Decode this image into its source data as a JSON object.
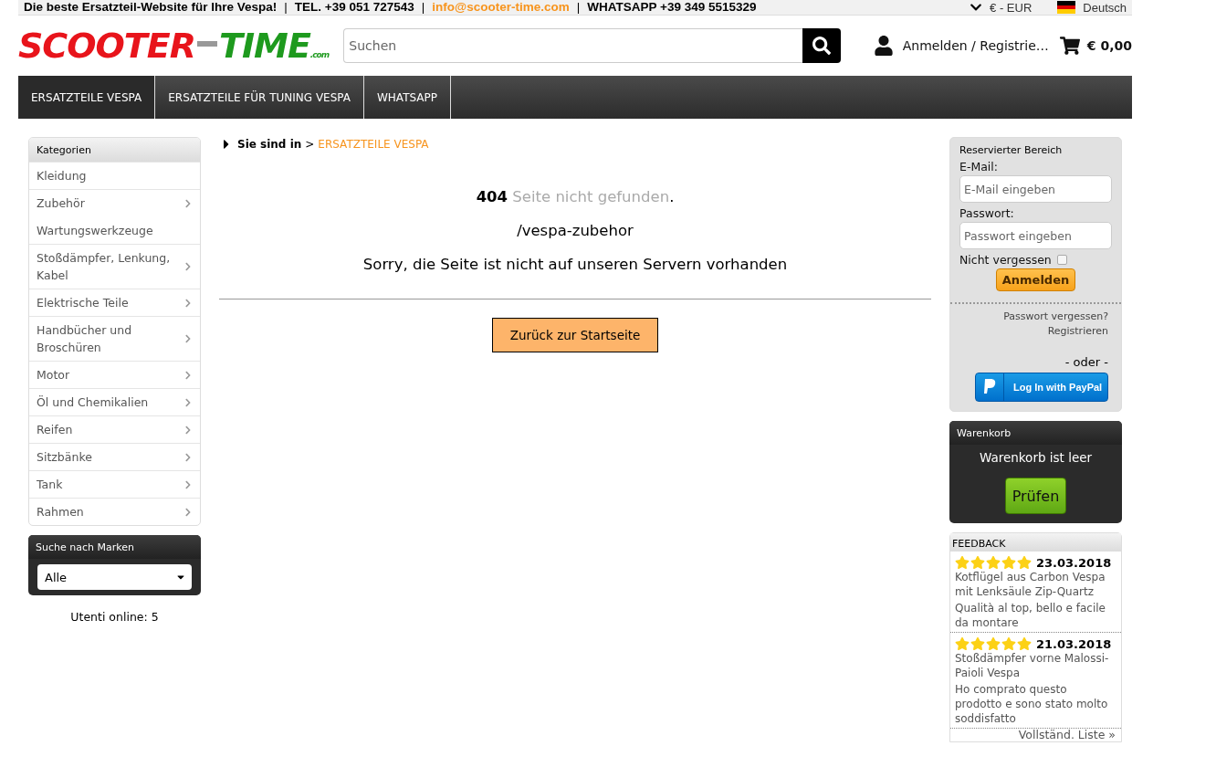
{
  "topbar": {
    "slogan": "Die beste Ersatzteil-Website für Ihre Vespa!",
    "phone": "TEL. +39 051 727543",
    "email": "info@scooter-time.com",
    "whatsapp": "WHATSAPP  +39 349 5515329",
    "currency": "€ - EUR",
    "language": "Deutsch",
    "separator": "|"
  },
  "logo": {
    "part_1": "SCOOTER",
    "part_2": "TIME",
    "suffix": ".com"
  },
  "search": {
    "placeholder": "Suchen"
  },
  "account": {
    "label": "Anmelden / Registrie…"
  },
  "cart_total": "€ 0,00",
  "nav": [
    {
      "label": "ERSATZTEILE VESPA",
      "selected": true
    },
    {
      "label": "ERSATZTEILE FÜR TUNING VESPA",
      "selected": false
    },
    {
      "label": "WHATSAPP",
      "selected": false
    }
  ],
  "categories": {
    "title": "Kategorien",
    "items": [
      {
        "label": "Kleidung",
        "has_children": false
      },
      {
        "label": "Zubehör",
        "has_children": true
      },
      {
        "label": "Wartungswerkzeuge",
        "has_children": false
      },
      {
        "label": "Stoßdämpfer, Lenkung, Kabel",
        "has_children": true
      },
      {
        "label": "Elektrische Teile",
        "has_children": true
      },
      {
        "label": "Handbücher und Broschüren",
        "has_children": true
      },
      {
        "label": "Motor",
        "has_children": true
      },
      {
        "label": "Öl und Chemikalien",
        "has_children": true
      },
      {
        "label": "Reifen",
        "has_children": true
      },
      {
        "label": "Sitzbänke",
        "has_children": true
      },
      {
        "label": "Tank",
        "has_children": true
      },
      {
        "label": "Rahmen",
        "has_children": true
      }
    ]
  },
  "brands": {
    "title": "Suche nach Marken",
    "value": "Alle"
  },
  "online": "Utenti online: 5",
  "breadcrumb": {
    "prefix": "Sie sind in",
    "separator": ">",
    "current": "ERSATZTEILE VESPA"
  },
  "error": {
    "code": "404",
    "message": "Seite nicht gefunden",
    "period": ".",
    "path": "/vespa-zubehor",
    "text": "Sorry, die Seite ist nicht auf unseren Servern vorhanden",
    "button": "Zurück zur Startseite"
  },
  "login": {
    "title": "Reservierter Bereich",
    "email_label": "E-Mail:",
    "email_placeholder": "E-Mail eingeben",
    "password_label": "Passwort:",
    "password_placeholder": "Passwort eingeben",
    "remember": "Nicht vergessen",
    "remember_checked": false,
    "submit": "Anmelden",
    "forgot": "Passwort vergessen?",
    "register": "Registrieren",
    "or": "- oder -",
    "paypal": "Log In with PayPal"
  },
  "cart": {
    "title": "Warenkorb",
    "empty": "Warenkorb ist leer",
    "button": "Prüfen"
  },
  "feedback": {
    "title": "FEEDBACK",
    "items": [
      {
        "stars": 5,
        "date": "23.03.2018",
        "product": "Kotflügel aus Carbon Vespa mit Lenksäule Zip-Quartz",
        "comment": "Qualità al top, bello e facile da montare"
      },
      {
        "stars": 5,
        "date": "21.03.2018",
        "product": "Stoßdämpfer vorne Malossi-Paioli Vespa",
        "comment": "Ho comprato questo prodotto e sono stato molto soddisfatto"
      }
    ],
    "more": "Vollständ. Liste »"
  }
}
